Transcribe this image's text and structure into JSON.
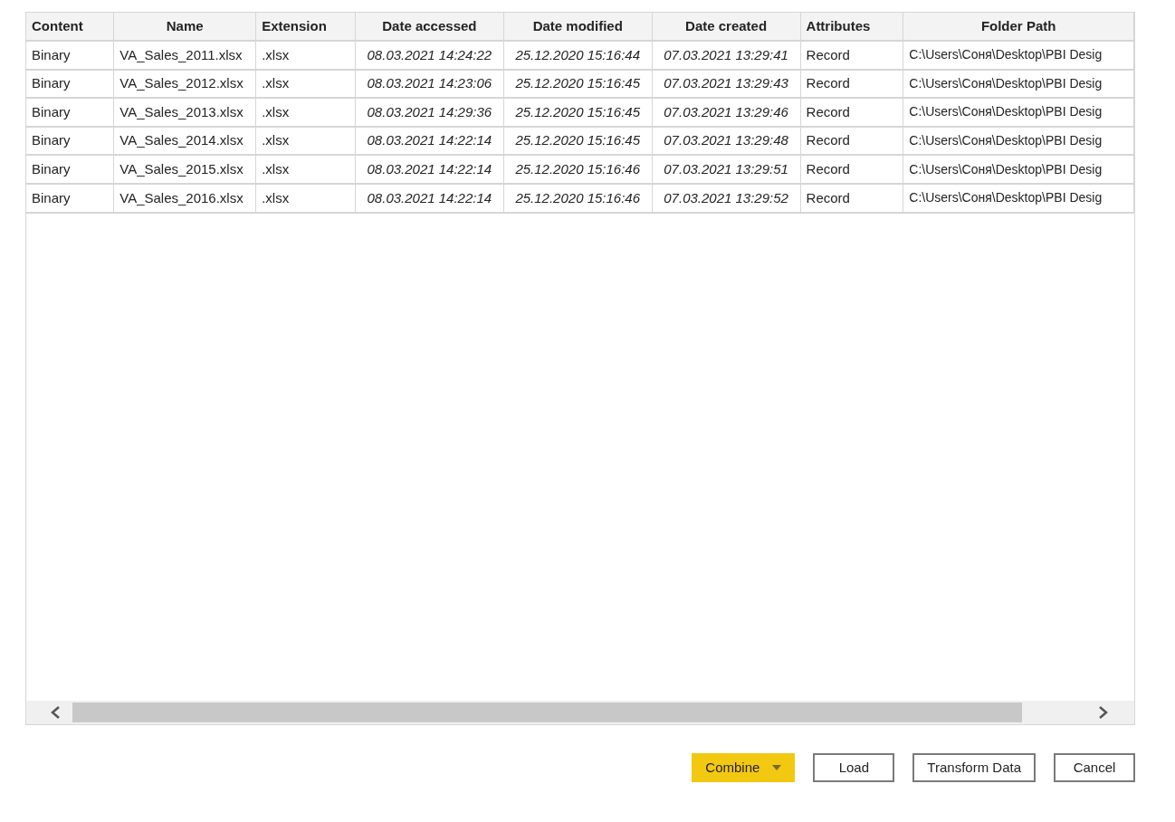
{
  "table": {
    "columns": [
      {
        "label": "Content",
        "kind": "text"
      },
      {
        "label": "Name",
        "kind": "text"
      },
      {
        "label": "Extension",
        "kind": "text"
      },
      {
        "label": "Date accessed",
        "kind": "datetime"
      },
      {
        "label": "Date modified",
        "kind": "datetime"
      },
      {
        "label": "Date created",
        "kind": "datetime"
      },
      {
        "label": "Attributes",
        "kind": "text"
      },
      {
        "label": "Folder Path",
        "kind": "text"
      }
    ],
    "rows": [
      [
        "Binary",
        "VA_Sales_2011.xlsx",
        ".xlsx",
        "08.03.2021 14:24:22",
        "25.12.2020 15:16:44",
        "07.03.2021 13:29:41",
        "Record",
        "C:\\Users\\Соня\\Desktop\\PBI Desig"
      ],
      [
        "Binary",
        "VA_Sales_2012.xlsx",
        ".xlsx",
        "08.03.2021 14:23:06",
        "25.12.2020 15:16:45",
        "07.03.2021 13:29:43",
        "Record",
        "C:\\Users\\Соня\\Desktop\\PBI Desig"
      ],
      [
        "Binary",
        "VA_Sales_2013.xlsx",
        ".xlsx",
        "08.03.2021 14:29:36",
        "25.12.2020 15:16:45",
        "07.03.2021 13:29:46",
        "Record",
        "C:\\Users\\Соня\\Desktop\\PBI Desig"
      ],
      [
        "Binary",
        "VA_Sales_2014.xlsx",
        ".xlsx",
        "08.03.2021 14:22:14",
        "25.12.2020 15:16:45",
        "07.03.2021 13:29:48",
        "Record",
        "C:\\Users\\Соня\\Desktop\\PBI Desig"
      ],
      [
        "Binary",
        "VA_Sales_2015.xlsx",
        ".xlsx",
        "08.03.2021 14:22:14",
        "25.12.2020 15:16:46",
        "07.03.2021 13:29:51",
        "Record",
        "C:\\Users\\Соня\\Desktop\\PBI Desig"
      ],
      [
        "Binary",
        "VA_Sales_2016.xlsx",
        ".xlsx",
        "08.03.2021 14:22:14",
        "25.12.2020 15:16:46",
        "07.03.2021 13:29:52",
        "Record",
        "C:\\Users\\Соня\\Desktop\\PBI Desig"
      ]
    ]
  },
  "buttons": [
    {
      "label": "Combine",
      "kind": "primary-dropdown"
    },
    {
      "label": "Load",
      "kind": "outline"
    },
    {
      "label": "Transform Data",
      "kind": "outline"
    },
    {
      "label": "Cancel",
      "kind": "outline"
    }
  ]
}
